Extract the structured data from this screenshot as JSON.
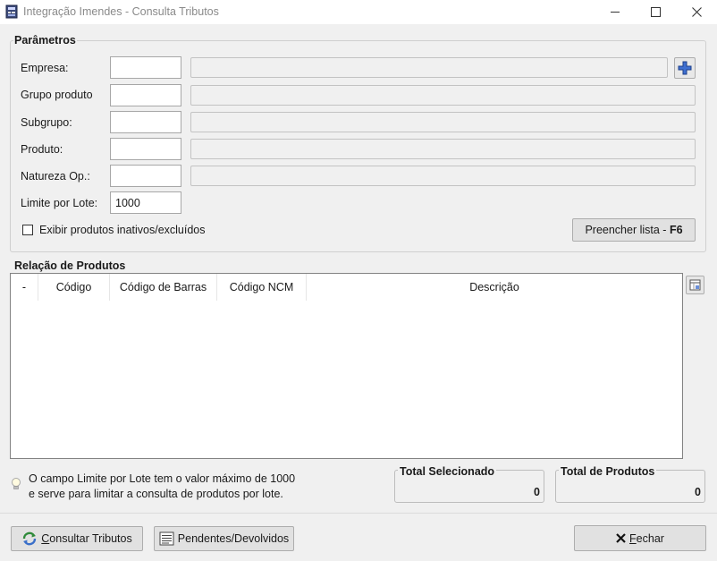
{
  "window": {
    "title": "Integração Imendes - Consulta Tributos",
    "minimize_glyph": "",
    "close_glyph": "✕"
  },
  "params": {
    "title": "Parâmetros",
    "fields": [
      {
        "label": "Empresa:",
        "value": "",
        "description": ""
      },
      {
        "label": "Grupo produto",
        "value": "",
        "description": ""
      },
      {
        "label": "Subgrupo:",
        "value": "",
        "description": ""
      },
      {
        "label": "Produto:",
        "value": "",
        "description": ""
      },
      {
        "label": "Natureza Op.:",
        "value": "",
        "description": ""
      }
    ],
    "limit_label": "Limite por Lote:",
    "limit_value": "1000",
    "show_inactive_label": "Exibir produtos inativos/excluídos",
    "show_inactive_checked": false,
    "fill_button_label": "Preencher lista - ",
    "fill_button_shortcut": "F6"
  },
  "products": {
    "title": "Relação de Produtos",
    "columns": [
      "-",
      "Código",
      "Código de Barras",
      "Código NCM",
      "Descrição"
    ],
    "rows": []
  },
  "info": {
    "line1": "O campo Limite por Lote tem o valor máximo de 1000",
    "line2": "e serve para limitar a consulta de produtos por lote."
  },
  "totals": {
    "selected_label": "Total Selecionado",
    "selected_value": "0",
    "products_label": "Total de Produtos",
    "products_value": "0"
  },
  "buttons": {
    "consult_accel": "C",
    "consult_rest": "onsultar Tributos",
    "pending": "Pendentes/Devolvidos",
    "close_accel": "F",
    "close_rest": "echar"
  },
  "colors": {
    "accent_blue": "#2a5bb8",
    "close_x": "#111111"
  }
}
